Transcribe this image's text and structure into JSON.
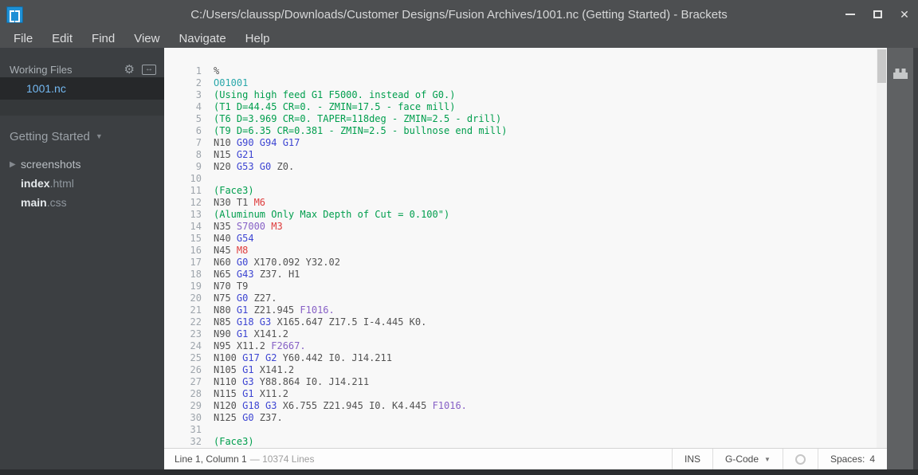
{
  "window": {
    "title": "C:/Users/claussp/Downloads/Customer Designs/Fusion Archives/1001.nc (Getting Started) - Brackets",
    "controls": [
      {
        "name": "minimize",
        "icon": "minimize-icon"
      },
      {
        "name": "maximize",
        "icon": "maximize-icon"
      },
      {
        "name": "close",
        "icon": "close-icon"
      }
    ]
  },
  "menu": {
    "items": [
      "File",
      "Edit",
      "Find",
      "View",
      "Navigate",
      "Help"
    ]
  },
  "sidebar": {
    "working_files_title": "Working Files",
    "working_files": [
      {
        "name": "1001.nc",
        "active": true
      }
    ],
    "project_name": "Getting Started",
    "project_tree": [
      {
        "type": "folder",
        "label": "screenshots"
      },
      {
        "type": "file",
        "base": "index",
        "ext": ".html"
      },
      {
        "type": "file",
        "base": "main",
        "ext": ".css"
      }
    ]
  },
  "editor": {
    "lines": [
      {
        "n": 1,
        "s": [
          [
            "%",
            "d"
          ]
        ]
      },
      {
        "n": 2,
        "s": [
          [
            "O01001",
            "o"
          ]
        ]
      },
      {
        "n": 3,
        "s": [
          [
            "(Using high feed G1 F5000. instead of G0.)",
            "c"
          ]
        ]
      },
      {
        "n": 4,
        "s": [
          [
            "(T1 D=44.45 CR=0. - ZMIN=17.5 - face mill)",
            "c"
          ]
        ]
      },
      {
        "n": 5,
        "s": [
          [
            "(T6 D=3.969 CR=0. TAPER=118deg - ZMIN=2.5 - drill)",
            "c"
          ]
        ]
      },
      {
        "n": 6,
        "s": [
          [
            "(T9 D=6.35 CR=0.381 - ZMIN=2.5 - bullnose end mill)",
            "c"
          ]
        ]
      },
      {
        "n": 7,
        "s": [
          [
            "N10 ",
            "d"
          ],
          [
            "G90 G94 G17",
            "k"
          ]
        ]
      },
      {
        "n": 8,
        "s": [
          [
            "N15 ",
            "d"
          ],
          [
            "G21",
            "k"
          ]
        ]
      },
      {
        "n": 9,
        "s": [
          [
            "N20 ",
            "d"
          ],
          [
            "G53 G0",
            "k"
          ],
          [
            " Z0.",
            "d"
          ]
        ]
      },
      {
        "n": 10,
        "s": []
      },
      {
        "n": 11,
        "s": [
          [
            "(Face3)",
            "c"
          ]
        ]
      },
      {
        "n": 12,
        "s": [
          [
            "N30 T1 ",
            "d"
          ],
          [
            "M6",
            "r"
          ]
        ]
      },
      {
        "n": 13,
        "s": [
          [
            "(Aluminum Only Max Depth of Cut = 0.100\")",
            "c"
          ]
        ]
      },
      {
        "n": 14,
        "s": [
          [
            "N35 ",
            "d"
          ],
          [
            "S7000",
            "p"
          ],
          [
            " ",
            "d"
          ],
          [
            "M3",
            "r"
          ]
        ]
      },
      {
        "n": 15,
        "s": [
          [
            "N40 ",
            "d"
          ],
          [
            "G54",
            "k"
          ]
        ]
      },
      {
        "n": 16,
        "s": [
          [
            "N45 ",
            "d"
          ],
          [
            "M8",
            "r"
          ]
        ]
      },
      {
        "n": 17,
        "s": [
          [
            "N60 ",
            "d"
          ],
          [
            "G0",
            "k"
          ],
          [
            " X170.092 Y32.02",
            "d"
          ]
        ]
      },
      {
        "n": 18,
        "s": [
          [
            "N65 ",
            "d"
          ],
          [
            "G43",
            "k"
          ],
          [
            " Z37. H1",
            "d"
          ]
        ]
      },
      {
        "n": 19,
        "s": [
          [
            "N70 T9",
            "d"
          ]
        ]
      },
      {
        "n": 20,
        "s": [
          [
            "N75 ",
            "d"
          ],
          [
            "G0",
            "k"
          ],
          [
            " Z27.",
            "d"
          ]
        ]
      },
      {
        "n": 21,
        "s": [
          [
            "N80 ",
            "d"
          ],
          [
            "G1",
            "k"
          ],
          [
            " Z21.945 ",
            "d"
          ],
          [
            "F1016.",
            "p"
          ]
        ]
      },
      {
        "n": 22,
        "s": [
          [
            "N85 ",
            "d"
          ],
          [
            "G18 G3",
            "k"
          ],
          [
            " X165.647 Z17.5 I-4.445 K0.",
            "d"
          ]
        ]
      },
      {
        "n": 23,
        "s": [
          [
            "N90 ",
            "d"
          ],
          [
            "G1",
            "k"
          ],
          [
            " X141.2",
            "d"
          ]
        ]
      },
      {
        "n": 24,
        "s": [
          [
            "N95 X11.2 ",
            "d"
          ],
          [
            "F2667.",
            "p"
          ]
        ]
      },
      {
        "n": 25,
        "s": [
          [
            "N100 ",
            "d"
          ],
          [
            "G17 G2",
            "k"
          ],
          [
            " Y60.442 I0. J14.211",
            "d"
          ]
        ]
      },
      {
        "n": 26,
        "s": [
          [
            "N105 ",
            "d"
          ],
          [
            "G1",
            "k"
          ],
          [
            " X141.2",
            "d"
          ]
        ]
      },
      {
        "n": 27,
        "s": [
          [
            "N110 ",
            "d"
          ],
          [
            "G3",
            "k"
          ],
          [
            " Y88.864 I0. J14.211",
            "d"
          ]
        ]
      },
      {
        "n": 28,
        "s": [
          [
            "N115 ",
            "d"
          ],
          [
            "G1",
            "k"
          ],
          [
            " X11.2",
            "d"
          ]
        ]
      },
      {
        "n": 29,
        "s": [
          [
            "N120 ",
            "d"
          ],
          [
            "G18 G3",
            "k"
          ],
          [
            " X6.755 Z21.945 I0. K4.445 ",
            "d"
          ],
          [
            "F1016.",
            "p"
          ]
        ]
      },
      {
        "n": 30,
        "s": [
          [
            "N125 ",
            "d"
          ],
          [
            "G0",
            "k"
          ],
          [
            " Z37.",
            "d"
          ]
        ]
      },
      {
        "n": 31,
        "s": []
      },
      {
        "n": 32,
        "s": [
          [
            "(Face3)",
            "c"
          ]
        ]
      }
    ]
  },
  "statusbar": {
    "cursor": "Line 1, Column 1",
    "lines_info": "— 10374 Lines",
    "overwrite_mode": "INS",
    "language": "G-Code",
    "spaces_label": "Spaces:",
    "spaces_value": "4"
  },
  "colors": {
    "default": "#535353",
    "comment": "#009E4D",
    "keyword": "#3D45D2",
    "mcode": "#DE3C3C",
    "fcode": "#8761C6",
    "ocode": "#2AA8AA",
    "accent_active_file": "#74B9F2",
    "titlebar_bg": "#4D4F51",
    "sidebar_bg": "#3C3F42",
    "editor_bg": "#F8F8F8"
  }
}
